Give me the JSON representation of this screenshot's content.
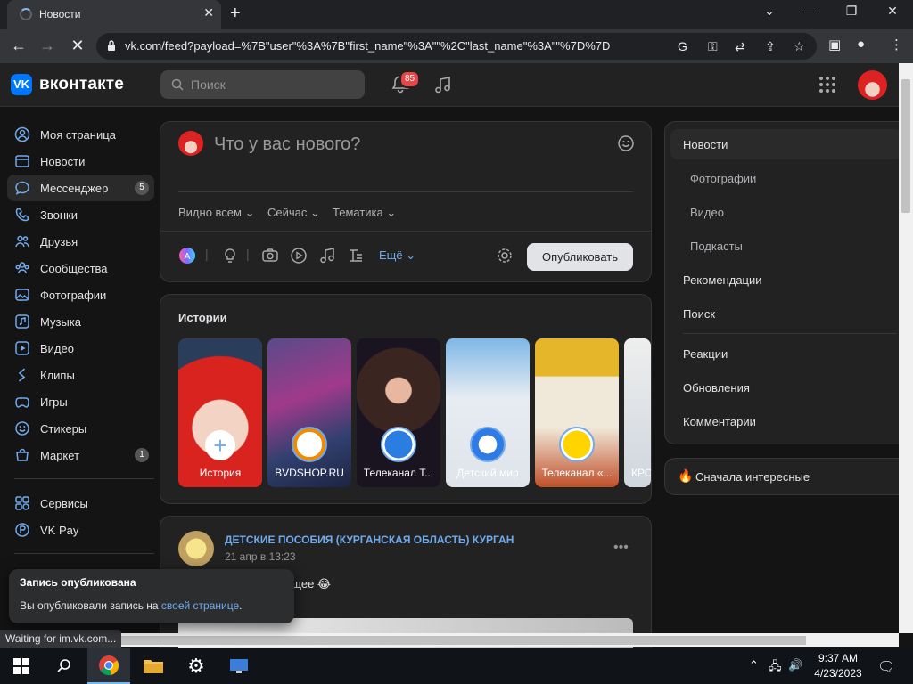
{
  "browser": {
    "tab_title": "Новости",
    "url": "vk.com/feed?payload=%7B\"user\"%3A%7B\"first_name\"%3A\"\"%2C\"last_name\"%3A\"\"%7D%7D",
    "status": "Waiting for im.vk.com..."
  },
  "header": {
    "brand": "вконтакте",
    "search_placeholder": "Поиск",
    "notifications_count": "85"
  },
  "sidebar": {
    "items": [
      {
        "label": "Моя страница",
        "icon": "user-circle-icon"
      },
      {
        "label": "Новости",
        "icon": "newspaper-icon"
      },
      {
        "label": "Мессенджер",
        "icon": "message-icon",
        "count": "5"
      },
      {
        "label": "Звонки",
        "icon": "phone-icon"
      },
      {
        "label": "Друзья",
        "icon": "friends-icon"
      },
      {
        "label": "Сообщества",
        "icon": "communities-icon"
      },
      {
        "label": "Фотографии",
        "icon": "photo-icon"
      },
      {
        "label": "Музыка",
        "icon": "music-icon"
      },
      {
        "label": "Видео",
        "icon": "video-icon"
      },
      {
        "label": "Клипы",
        "icon": "clips-icon"
      },
      {
        "label": "Игры",
        "icon": "gamepad-icon"
      },
      {
        "label": "Стикеры",
        "icon": "sticker-icon"
      },
      {
        "label": "Маркет",
        "icon": "market-icon",
        "count": "1"
      }
    ],
    "services": [
      {
        "label": "Сервисы",
        "icon": "services-icon"
      },
      {
        "label": "VK Pay",
        "icon": "vkpay-icon"
      }
    ]
  },
  "composer": {
    "placeholder": "Что у вас нового?",
    "visibility": "Видно всем",
    "when": "Сейчас",
    "topic": "Тематика",
    "more": "Ещё",
    "publish": "Опубликовать"
  },
  "stories": {
    "heading": "Истории",
    "items": [
      {
        "label": "История"
      },
      {
        "label": "BVDSHOP.RU"
      },
      {
        "label": "Телеканал Т..."
      },
      {
        "label": "Детский мир"
      },
      {
        "label": "Телеканал «..."
      },
      {
        "label": "КРО"
      }
    ]
  },
  "post": {
    "author": "ДЕТСКИЕ ПОСОБИЯ (КУРГАНСКАЯ ОБЛАСТЬ) КУРГАН",
    "date": "21 апр в 13:23",
    "text_line1": "будущее 😂",
    "text_line2": "?"
  },
  "right_menu": {
    "items": [
      "Новости",
      "Фотографии",
      "Видео",
      "Подкасты",
      "Рекомендации",
      "Поиск",
      "Реакции",
      "Обновления",
      "Комментарии"
    ],
    "sort": "Сначала интересные"
  },
  "toast": {
    "title": "Запись опубликована",
    "text": "Вы опубликовали запись на ",
    "link": "своей странице",
    "end": "."
  },
  "taskbar": {
    "time": "9:37 AM",
    "date": "4/23/2023"
  },
  "colors": {
    "accent": "#71aaeb",
    "brand": "#0077ff",
    "badge": "#e64646"
  }
}
